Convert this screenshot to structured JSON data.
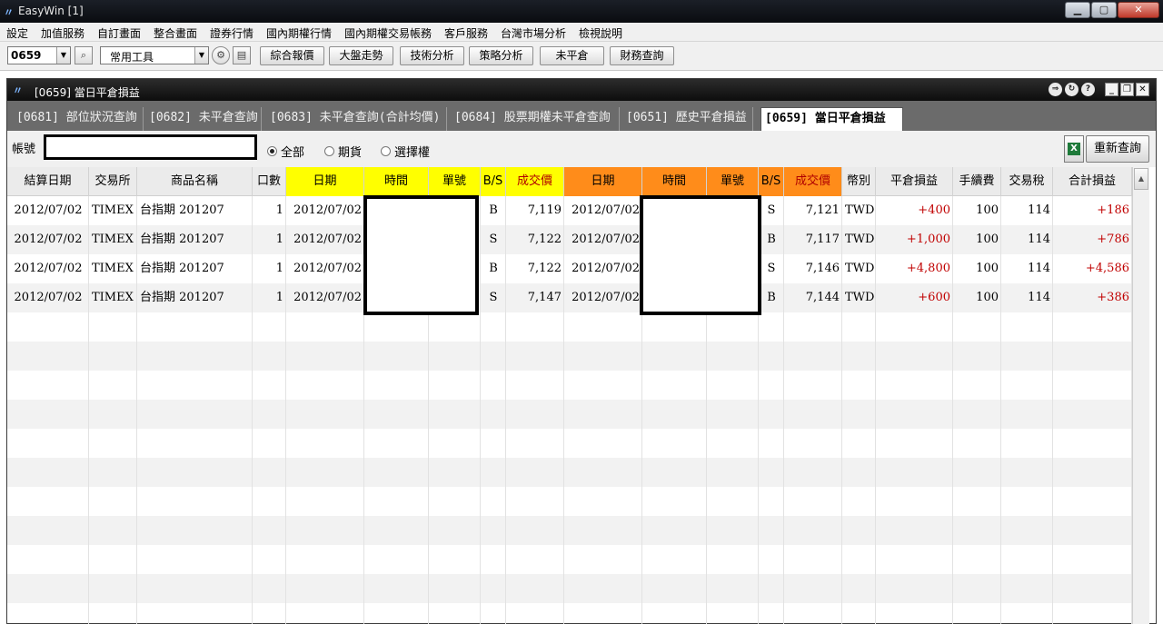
{
  "window": {
    "title": "EasyWin  [1]"
  },
  "menu": [
    "設定",
    "加值服務",
    "自訂畫面",
    "整合畫面",
    "證券行情",
    "國內期權行情",
    "國內期權交易帳務",
    "客戶服務",
    "台灣市場分析",
    "檢視說明"
  ],
  "toolbar": {
    "code_value": "0659",
    "tools_value": "常用工具",
    "buttons": [
      "綜合報價",
      "大盤走勢",
      "技術分析",
      "策略分析",
      "未平倉",
      "財務查詢"
    ]
  },
  "inner_window": {
    "title": "[0659] 當日平倉損益"
  },
  "tabs": [
    "[0681] 部位狀況查詢",
    "[0682] 未平倉查詢",
    "[0683] 未平倉查詢(合計均價)",
    "[0684] 股票期權未平倉查詢",
    "[0651] 歷史平倉損益",
    "[0659] 當日平倉損益"
  ],
  "filter": {
    "account_label": "帳號",
    "account_value": "",
    "radios": [
      "全部",
      "期貨",
      "選擇權"
    ],
    "selected": "全部",
    "query_button": "重新查詢"
  },
  "table": {
    "headers": [
      "結算日期",
      "交易所",
      "商品名稱",
      "口數",
      "日期",
      "時間",
      "單號",
      "B/S",
      "成交價",
      "日期",
      "時間",
      "單號",
      "B/S",
      "成交價",
      "幣別",
      "平倉損益",
      "手續費",
      "交易稅",
      "合計損益"
    ],
    "rows": [
      [
        "2012/07/02",
        "TIMEX",
        "台指期 201207",
        "1",
        "2012/07/02",
        "",
        "",
        "B",
        "7,119",
        "2012/07/02",
        "",
        "",
        "S",
        "7,121",
        "TWD",
        "+400",
        "100",
        "114",
        "+186"
      ],
      [
        "2012/07/02",
        "TIMEX",
        "台指期 201207",
        "1",
        "2012/07/02",
        "",
        "",
        "S",
        "7,122",
        "2012/07/02",
        "",
        "",
        "B",
        "7,117",
        "TWD",
        "+1,000",
        "100",
        "114",
        "+786"
      ],
      [
        "2012/07/02",
        "TIMEX",
        "台指期 201207",
        "1",
        "2012/07/02",
        "",
        "",
        "B",
        "7,122",
        "2012/07/02",
        "",
        "",
        "S",
        "7,146",
        "TWD",
        "+4,800",
        "100",
        "114",
        "+4,586"
      ],
      [
        "2012/07/02",
        "TIMEX",
        "台指期 201207",
        "1",
        "2012/07/02",
        "",
        "",
        "S",
        "7,147",
        "2012/07/02",
        "",
        "",
        "B",
        "7,144",
        "TWD",
        "+600",
        "100",
        "114",
        "+386"
      ]
    ]
  },
  "colors": {
    "open_header": "#ffff00",
    "close_header": "#ff8c1a",
    "profit": "#c00000"
  }
}
